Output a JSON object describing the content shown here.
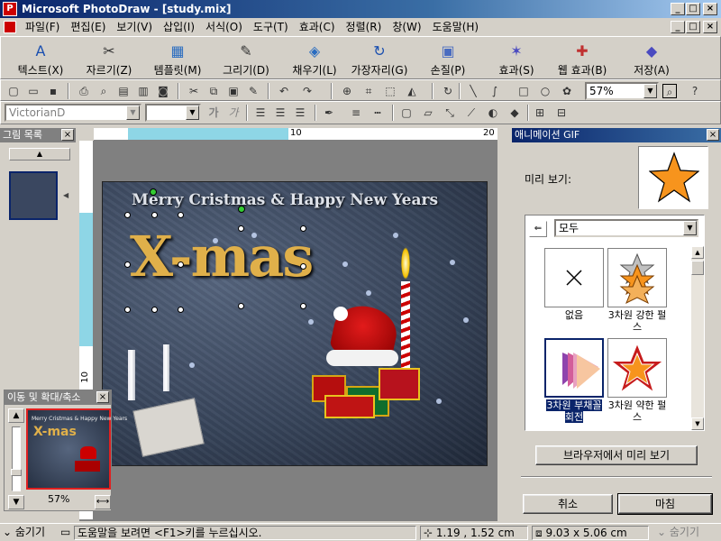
{
  "window": {
    "title": "Microsoft PhotoDraw - [study.mix]",
    "min": "_",
    "max": "□",
    "close": "×"
  },
  "menu": [
    "파일(F)",
    "편집(E)",
    "보기(V)",
    "삽입(I)",
    "서식(O)",
    "도구(T)",
    "효과(C)",
    "정렬(R)",
    "창(W)",
    "도움말(H)"
  ],
  "bigtoolbar": [
    {
      "label": "텍스트(X)",
      "icon": "text-icon",
      "glyph": "A"
    },
    {
      "label": "자르기(Z)",
      "icon": "scissors-icon",
      "glyph": "✂"
    },
    {
      "label": "템플릿(M)",
      "icon": "template-icon",
      "glyph": "▦"
    },
    {
      "label": "그리기(D)",
      "icon": "draw-icon",
      "glyph": "✎"
    },
    {
      "label": "채우기(L)",
      "icon": "fill-icon",
      "glyph": "◈"
    },
    {
      "label": "가장자리(G)",
      "icon": "edge-icon",
      "glyph": "↻"
    },
    {
      "label": "손질(P)",
      "icon": "touchup-icon",
      "glyph": "▣"
    },
    {
      "label": "효과(S)",
      "icon": "effects-icon",
      "glyph": "✶"
    },
    {
      "label": "웹 효과(B)",
      "icon": "web-effects-icon",
      "glyph": "✚"
    },
    {
      "label": "저장(A)",
      "icon": "save-icon",
      "glyph": "◆"
    }
  ],
  "formatbar": {
    "font_name": "VictorianD",
    "font_size": "",
    "bold": "가",
    "italic": "가"
  },
  "zoom": {
    "value": "57%"
  },
  "ruler": {
    "mark1": "10",
    "mark2": "20",
    "left_mark": "10"
  },
  "left_panel": {
    "title": "그림 목록"
  },
  "navigator": {
    "title": "이동 및 확대/축소",
    "zoom": "57%",
    "thumb_title": "Merry Cristmas & Happy New Years",
    "thumb_xmas": "X-mas"
  },
  "canvas": {
    "headline": "Merry Cristmas & Happy New Years",
    "xmas": "X-mas"
  },
  "right_panel": {
    "title": "애니메이션 GIF",
    "preview_label": "미리 보기:",
    "filter": "모두",
    "effects": [
      {
        "label": "없음",
        "icon": "none-effect-icon"
      },
      {
        "label": "3차원 강한 펄스",
        "icon": "strong-pulse-icon"
      },
      {
        "label": "3차원 부채꼴 회전",
        "icon": "fan-rotate-icon",
        "selected": true
      },
      {
        "label": "3차원 약한 펄스",
        "icon": "weak-pulse-icon"
      }
    ],
    "browser_preview": "브라우저에서 미리 보기",
    "cancel": "취소",
    "finish": "마침"
  },
  "status": {
    "hide_left": "숨기기",
    "help": "도움말을 보려면 <F1>키를 누르십시오.",
    "position": "1.19 , 1.52 cm",
    "size": "9.03 x 5.06 cm",
    "hide_right": "숨기기"
  },
  "colors": {
    "title_bar": "#0a246a",
    "accent_star": "#f7941d",
    "selection": "#0a246a"
  }
}
